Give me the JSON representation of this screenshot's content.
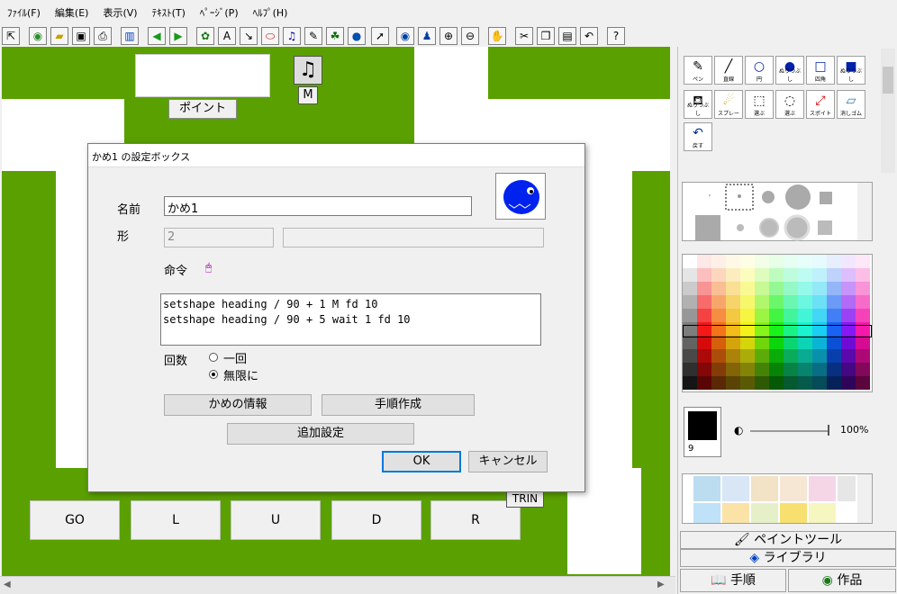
{
  "menu": [
    "ﾌｧｲﾙ(F)",
    "編集(E)",
    "表示(V)",
    "ﾃｷｽﾄ(T)",
    "ﾍﾟｰｼﾞ(P)",
    "ﾍﾙﾌﾟ(H)"
  ],
  "canvas": {
    "point_label": "ポイント",
    "music_label": "M",
    "trin_label": "TRIN",
    "pad_buttons": [
      "GO",
      "L",
      "U",
      "D",
      "R"
    ]
  },
  "dialog": {
    "title": "かめ1 の設定ボックス",
    "name_label": "名前",
    "name_value": "かめ1",
    "shape_label": "形",
    "shape_value": "2",
    "command_label": "命令",
    "commands": [
      "setshape heading / 90 + 1 M fd 10",
      "setshape heading / 90 + 5 wait 1 fd 10"
    ],
    "count_label": "回数",
    "radio_once": "一回",
    "radio_infinite": "無限に",
    "info_button": "かめの情報",
    "procedure_button": "手順作成",
    "extra_button": "追加設定",
    "ok_button": "OK",
    "cancel_button": "キャンセル"
  },
  "tools": [
    {
      "label": "ペン",
      "icon": "pencil-icon"
    },
    {
      "label": "直線",
      "icon": "line-icon"
    },
    {
      "label": "円",
      "icon": "circle-icon"
    },
    {
      "label": "ぬりつぶし",
      "icon": "filled-circle-icon"
    },
    {
      "label": "四角",
      "icon": "square-icon"
    },
    {
      "label": "ぬりつぶし",
      "icon": "filled-square-icon"
    },
    {
      "label": "ぬりつぶし",
      "icon": "bucket-icon"
    },
    {
      "label": "スプレー",
      "icon": "spray-icon"
    },
    {
      "label": "選ぶ",
      "icon": "select-rect-icon"
    },
    {
      "label": "選ぶ",
      "icon": "lasso-icon"
    },
    {
      "label": "スポイト",
      "icon": "dropper-icon"
    },
    {
      "label": "消しゴム",
      "icon": "eraser-icon"
    },
    {
      "label": "戻す",
      "icon": "undo-icon"
    }
  ],
  "brush": {
    "size_value": "9",
    "opacity": "100%"
  },
  "tabs": {
    "paint_tool": "ペイントツール",
    "library": "ライブラリ",
    "procedure": "手順",
    "works": "作品"
  },
  "colors": {
    "canvas_green": "#5aa000",
    "accent": "#0078d7"
  }
}
